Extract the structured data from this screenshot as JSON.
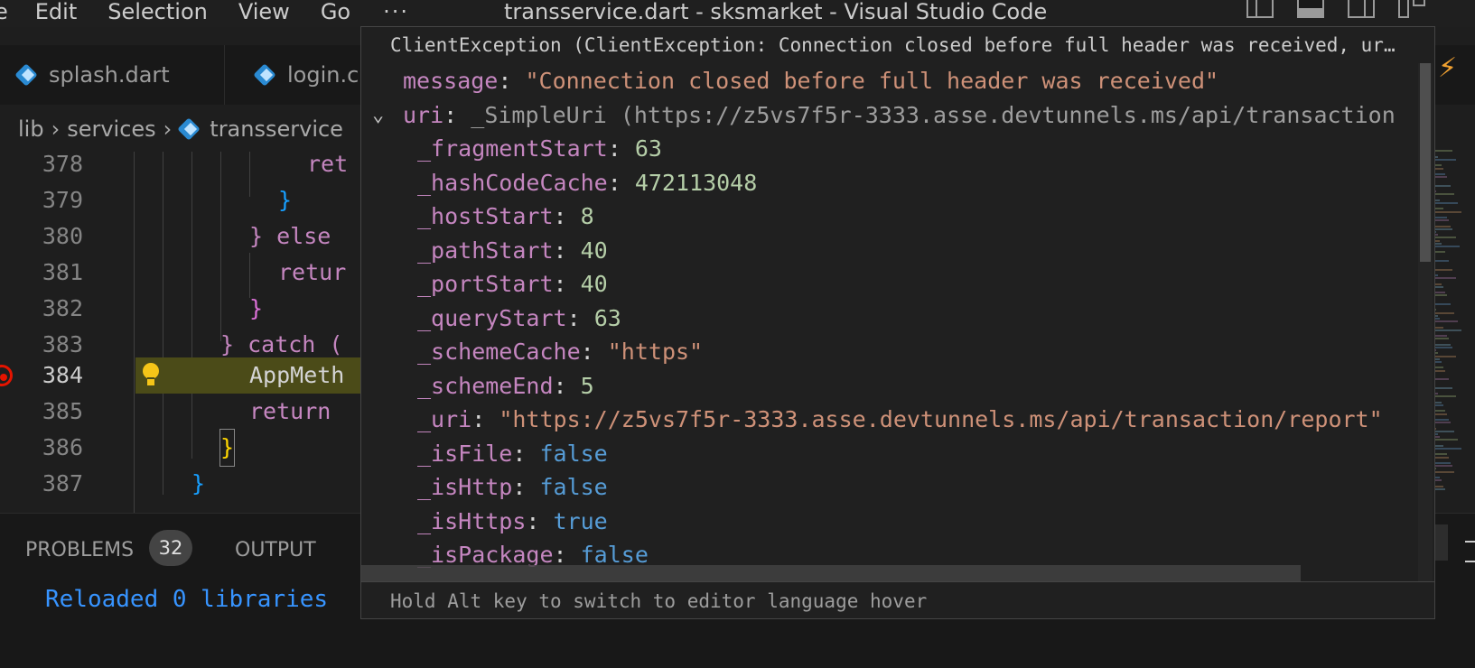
{
  "window": {
    "title": "transservice.dart - sksmarket - Visual Studio Code",
    "menu": [
      "e",
      "Edit",
      "Selection",
      "View",
      "Go",
      "···"
    ]
  },
  "tabs": [
    {
      "label": "splash.dart",
      "icon": "dart-file-icon"
    },
    {
      "label": "login.c",
      "icon": "dart-file-icon"
    }
  ],
  "breadcrumb": [
    "lib",
    "services",
    "transservice"
  ],
  "editor": {
    "lines": [
      {
        "num": "378",
        "text": "ret"
      },
      {
        "num": "379",
        "text": "}"
      },
      {
        "num": "380",
        "text": "} else"
      },
      {
        "num": "381",
        "text": "retur"
      },
      {
        "num": "382",
        "text": "}"
      },
      {
        "num": "383",
        "text": "} catch ("
      },
      {
        "num": "384",
        "text": "AppMeth"
      },
      {
        "num": "385",
        "text": "return"
      },
      {
        "num": "386",
        "text": "}"
      },
      {
        "num": "387",
        "text": "}"
      }
    ],
    "active_line": "384"
  },
  "hover": {
    "header": "ClientException (ClientException: Connection closed before full header was received, ur…",
    "rows": [
      {
        "key": "message",
        "sep": ": ",
        "value": "\"Connection closed before full header was received\"",
        "type": "string",
        "indent": 0
      },
      {
        "key": "uri",
        "sep": ": ",
        "value": "_SimpleUri (https://z5vs7f5r-3333.asse.devtunnels.ms/api/transaction",
        "type": "type",
        "indent": 0,
        "expanded": true
      },
      {
        "key": "_fragmentStart",
        "sep": ": ",
        "value": "63",
        "type": "number",
        "indent": 1
      },
      {
        "key": "_hashCodeCache",
        "sep": ": ",
        "value": "472113048",
        "type": "number",
        "indent": 1
      },
      {
        "key": "_hostStart",
        "sep": ": ",
        "value": "8",
        "type": "number",
        "indent": 1
      },
      {
        "key": "_pathStart",
        "sep": ": ",
        "value": "40",
        "type": "number",
        "indent": 1
      },
      {
        "key": "_portStart",
        "sep": ": ",
        "value": "40",
        "type": "number",
        "indent": 1
      },
      {
        "key": "_queryStart",
        "sep": ": ",
        "value": "63",
        "type": "number",
        "indent": 1
      },
      {
        "key": "_schemeCache",
        "sep": ": ",
        "value": "\"https\"",
        "type": "string",
        "indent": 1
      },
      {
        "key": "_schemeEnd",
        "sep": ": ",
        "value": "5",
        "type": "number",
        "indent": 1
      },
      {
        "key": "_uri",
        "sep": ": ",
        "value": "\"https://z5vs7f5r-3333.asse.devtunnels.ms/api/transaction/report\"",
        "type": "string",
        "indent": 1
      },
      {
        "key": "_isFile",
        "sep": ": ",
        "value": "false",
        "type": "bool",
        "indent": 1
      },
      {
        "key": "_isHttp",
        "sep": ": ",
        "value": "false",
        "type": "bool",
        "indent": 1
      },
      {
        "key": "_isHttps",
        "sep": ": ",
        "value": "true",
        "type": "bool",
        "indent": 1
      },
      {
        "key": "_isPackage",
        "sep": ": ",
        "value": "false",
        "type": "bool",
        "indent": 1
      }
    ],
    "footer": "Hold Alt key to switch to editor language hover"
  },
  "panel": {
    "tabs": [
      "PROBLEMS",
      "OUTPUT"
    ],
    "problems_count": "32",
    "output_text": "Reloaded 0 libraries"
  },
  "colors": {
    "string": "#ce9178",
    "number": "#b5cea8",
    "keyword": "#c586c0",
    "bool": "#569cd6",
    "link": "#3794ff"
  }
}
